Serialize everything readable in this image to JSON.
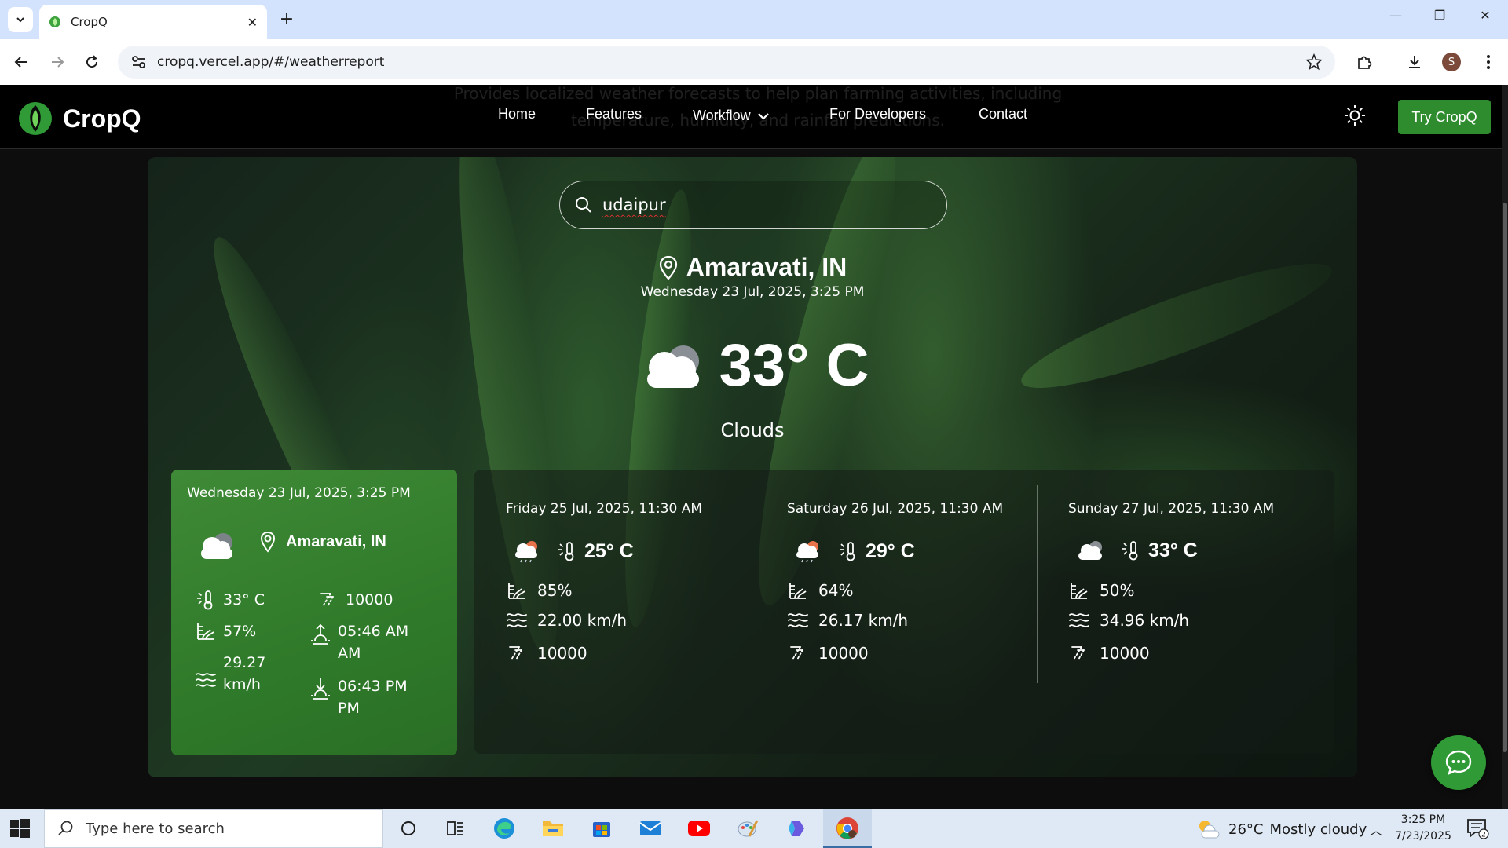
{
  "browser": {
    "tab_title": "CropQ",
    "url": "cropq.vercel.app/#/weatherreport",
    "profile_initial": "S"
  },
  "site": {
    "brand": "CropQ",
    "ghost_text": "Provides localized weather forecasts to help plan farming activities, including temperature, humidity, and rainfall predictions.",
    "nav": {
      "home": "Home",
      "features": "Features",
      "workflow": "Workflow",
      "developers": "For Developers",
      "contact": "Contact"
    },
    "try_button": "Try CropQ"
  },
  "weather": {
    "search_value": "udaipur",
    "location": "Amaravati, IN",
    "datetime": "Wednesday 23 Jul, 2025, 3:25 PM",
    "temperature": "33° C",
    "condition": "Clouds",
    "current": {
      "date": "Wednesday 23 Jul, 2025, 3:25 PM",
      "location": "Amaravati, IN",
      "temp": "33° C",
      "visibility": "10000",
      "humidity": "57%",
      "sunrise_time": "05:46 AM",
      "sunrise_ampm": "AM",
      "wind_value": "29.27",
      "wind_unit": "km/h",
      "sunset_time": "06:43 PM",
      "sunset_ampm": "PM"
    },
    "forecast": [
      {
        "date": "Friday 25 Jul, 2025, 11:30 AM",
        "temp": "25° C",
        "humidity": "85%",
        "wind": "22.00 km/h",
        "visibility": "10000",
        "icon": "rain-cloud-icon"
      },
      {
        "date": "Saturday 26 Jul, 2025, 11:30 AM",
        "temp": "29° C",
        "humidity": "64%",
        "wind": "26.17 km/h",
        "visibility": "10000",
        "icon": "rain-cloud-icon"
      },
      {
        "date": "Sunday 27 Jul, 2025, 11:30 AM",
        "temp": "33° C",
        "humidity": "50%",
        "wind": "34.96 km/h",
        "visibility": "10000",
        "icon": "cloud-icon"
      }
    ]
  },
  "taskbar": {
    "search_placeholder": "Type here to search",
    "weather_temp": "26°C",
    "weather_text": "Mostly cloudy",
    "time": "3:25 PM",
    "date": "7/23/2025",
    "notification_count": "2"
  },
  "colors": {
    "accent_green": "#2e8b2e",
    "card_green": "#3f8a36",
    "chrome_blue": "#d3e3fd"
  }
}
